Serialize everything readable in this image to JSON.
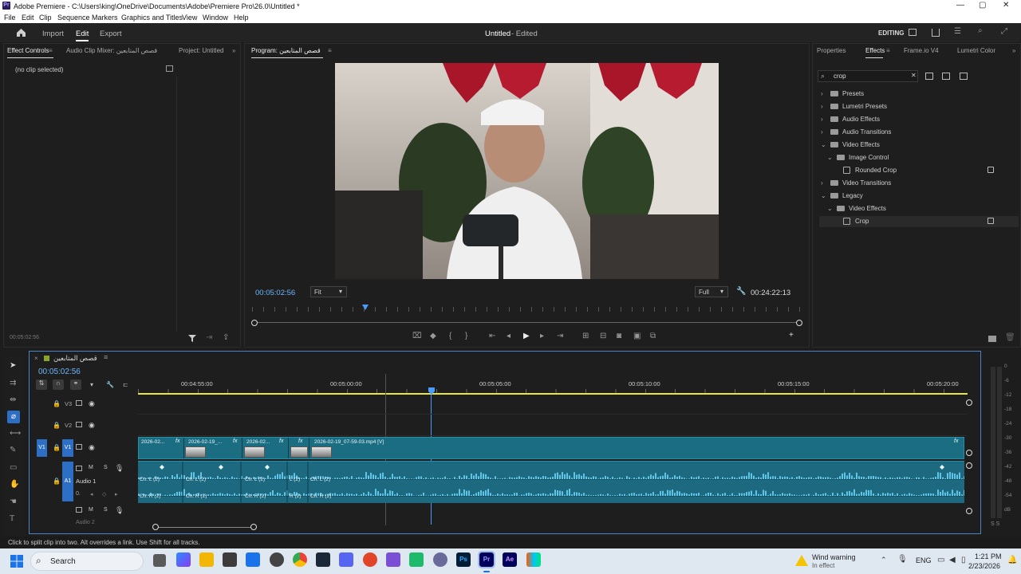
{
  "window": {
    "title": "Adobe Premiere - C:\\Users\\king\\OneDrive\\Documents\\Adobe\\Premiere Pro\\26.0\\Untitled *",
    "logo": "Pr",
    "controls": [
      "—",
      "▢",
      "✕"
    ]
  },
  "menu": [
    "File",
    "Edit",
    "Clip",
    "Sequence",
    "Markers",
    "Graphics and Titles",
    "View",
    "Window",
    "Help"
  ],
  "header": {
    "import": "Import",
    "edit": "Edit",
    "export": "Export",
    "project_title": "Untitled",
    "project_status": "- Edited",
    "workspace": "EDITING"
  },
  "effect_controls": {
    "tabs": [
      "Effect Controls",
      "Audio Clip Mixer: قصص المتابعين",
      "Project: Untitled"
    ],
    "no_clip": "(no clip selected)",
    "timecode": "00:05:02:56"
  },
  "program": {
    "tab": "Program: قصص المتابعين",
    "timecode": "00:05:02:56",
    "fit": "Fit",
    "quality": "Full",
    "duration": "00:24:22:13"
  },
  "effects_panel": {
    "tabs": [
      "Properties",
      "Effects",
      "Frame.io V4",
      "Lumetri Color"
    ],
    "search": "crop",
    "tree": [
      {
        "label": "Presets",
        "depth": 0,
        "kind": "folder",
        "open": false
      },
      {
        "label": "Lumetri Presets",
        "depth": 0,
        "kind": "folder",
        "open": false
      },
      {
        "label": "Audio Effects",
        "depth": 0,
        "kind": "folder",
        "open": false
      },
      {
        "label": "Audio Transitions",
        "depth": 0,
        "kind": "folder",
        "open": false
      },
      {
        "label": "Video Effects",
        "depth": 0,
        "kind": "folder",
        "open": true
      },
      {
        "label": "Image Control",
        "depth": 1,
        "kind": "folder",
        "open": true
      },
      {
        "label": "Rounded Crop",
        "depth": 2,
        "kind": "effect",
        "accel": true
      },
      {
        "label": "Video Transitions",
        "depth": 0,
        "kind": "folder",
        "open": false
      },
      {
        "label": "Legacy",
        "depth": 0,
        "kind": "folder",
        "open": true
      },
      {
        "label": "Video Effects",
        "depth": 1,
        "kind": "folder",
        "open": true
      },
      {
        "label": "Crop",
        "depth": 2,
        "kind": "effect",
        "accel": true,
        "selected": true
      }
    ]
  },
  "timeline": {
    "sequence_name": "قصص المتابعين",
    "timecode": "00:05:02:56",
    "ruler": [
      "00:04:55:00",
      "00:05:00:00",
      "00:05:05:00",
      "00:05:10:00",
      "00:05:15:00",
      "00:05:20:00"
    ],
    "tracks": {
      "v3": "V3",
      "v2": "V2",
      "v1": "V1",
      "a1": "A1",
      "audio1": "Audio 1",
      "a2": "Audio 2",
      "zero": "0."
    },
    "video_clips": [
      {
        "label": "2026-02..."
      },
      {
        "label": "2026-02-19_..."
      },
      {
        "label": "2026-02..."
      },
      {
        "label": ""
      },
      {
        "label": "2026-02-19_07-59-03.mp4 [V]"
      }
    ],
    "audio_left": [
      "Ch. L (2)",
      "Ch. L (2)",
      "Ch. L (2)",
      "L (2)",
      "Ch. L (2)"
    ],
    "audio_right": [
      "Ch. R (2)",
      "Ch. R (2)",
      "Ch. R (2)",
      "R (2)",
      "Ch. R (2)"
    ],
    "meter_labels": [
      "0",
      "-6",
      "-12",
      "-18",
      "-24",
      "-30",
      "-36",
      "-42",
      "-48",
      "-54",
      "dB"
    ],
    "meter_ss": "S S",
    "fx": "fx",
    "mute": "M",
    "solo": "S"
  },
  "status_bar": "Click to split clip into two. Alt overrides a link. Use Shift for all tracks.",
  "taskbar": {
    "search": "Search",
    "weather_title": "Wind warning",
    "weather_sub": "In effect",
    "lang": "ENG",
    "time": "1:21 PM",
    "date": "2/23/2026"
  },
  "colors": {
    "accent": "#2d8ceb",
    "clip": "#1b6d82",
    "waveform": "#5fc4e6",
    "ruler_bar": "#e8e63a"
  }
}
